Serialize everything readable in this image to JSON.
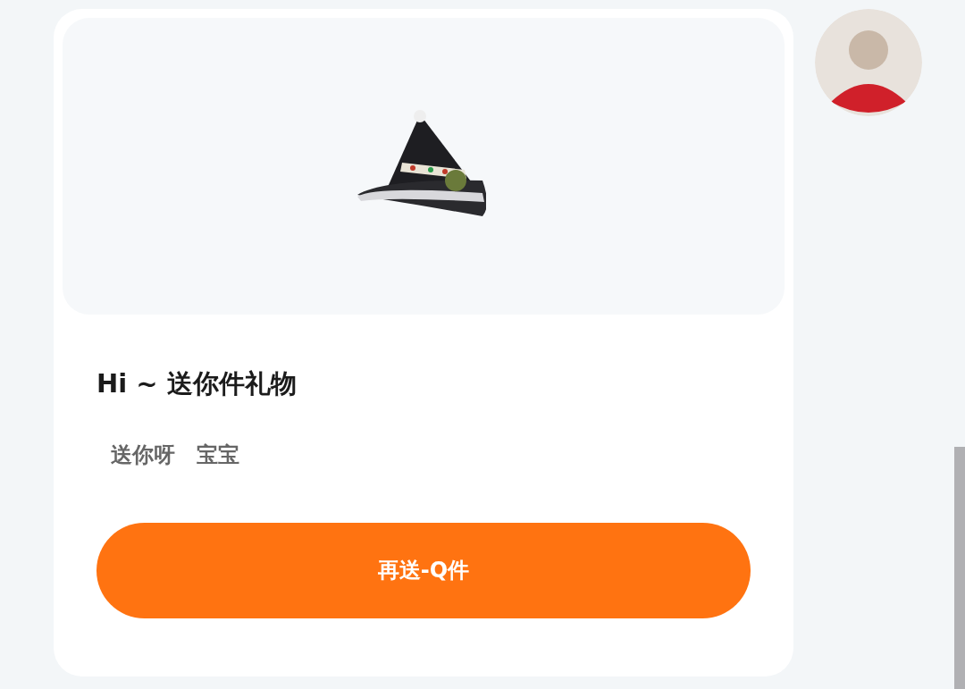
{
  "gift_card": {
    "title": "Hi ~ 送你件礼物",
    "message": "送你呀　宝宝",
    "button": "再送-Q件"
  }
}
